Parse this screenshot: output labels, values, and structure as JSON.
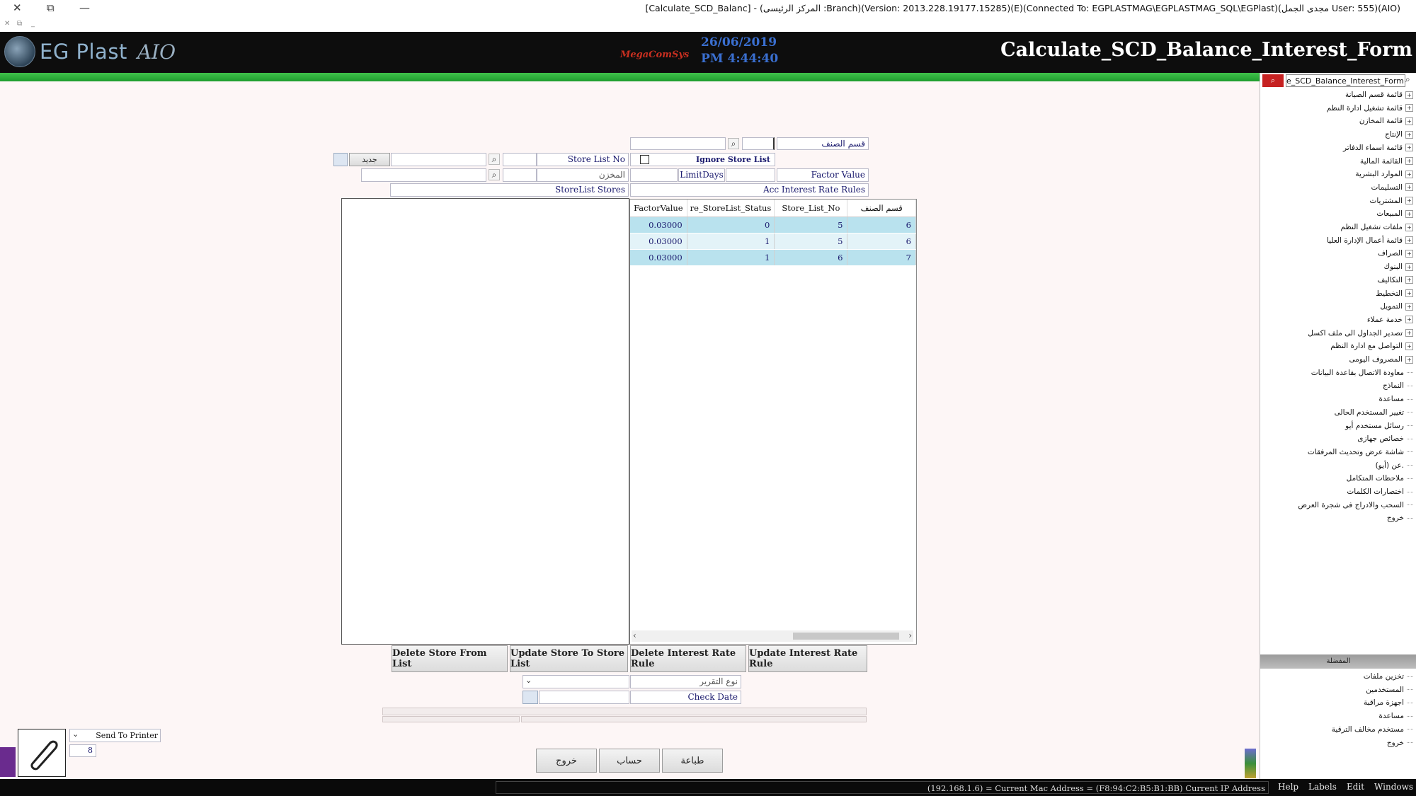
{
  "window": {
    "title": "[Calculate_SCD_Balanc] - (المركز الرئيسى :Branch)(Version: 2013.228.19177.15285)(E)(Connected To: EGPLASTMAG\\EGPLASTMAG_SQL\\EGPlast)(مجدى الجمل User: 555)(AIO)",
    "close_glyph": "✕",
    "restore_glyph": "⧉",
    "minimize_glyph": "—"
  },
  "header": {
    "logo_name": "EG Plast",
    "logo_suffix": "AIO",
    "mini_logo": "MegaComSys",
    "date": "26/06/2019",
    "time": "PM 4:44:40",
    "form_title": "Calculate_SCD_Balance_Interest_Form"
  },
  "form": {
    "item_category_label": "قسم الصنف",
    "item_category_value": "",
    "item_category_desc": "",
    "ignore_store_list_label": "Ignore Store List",
    "ignore_store_list_checked": false,
    "store_list_no_label": "Store List No",
    "store_list_no_value": "",
    "store_list_name": "",
    "new_label": "جديد",
    "factor_value_label": "Factor Value",
    "factor_value": "",
    "limit_days_label": "LimitDays",
    "limit_days_value": "",
    "store_label": "المخزن",
    "store_value": "",
    "store_name": "",
    "acc_interest_rate_rules_label": "Acc Interest Rate Rules",
    "storelist_stores_label": "StoreList Stores"
  },
  "grid": {
    "columns": [
      "FactorValue",
      "re_StoreList_Status",
      "Store_List_No",
      "قسم الصنف"
    ],
    "rows": [
      {
        "factor": "0.03000",
        "status": "0",
        "store_list_no": "5",
        "category": "6"
      },
      {
        "factor": "0.03000",
        "status": "1",
        "store_list_no": "5",
        "category": "6"
      },
      {
        "factor": "0.03000",
        "status": "1",
        "store_list_no": "6",
        "category": "7"
      }
    ]
  },
  "actions": {
    "delete_store": "Delete Store From List",
    "update_store": "Update Store To Store List",
    "delete_rule": "Delete Interest Rate Rule",
    "update_rule": "Update Interest Rate Rule"
  },
  "report": {
    "report_type_label": "نوع التقرير",
    "report_type_value": "",
    "check_date_label": "Check Date",
    "check_date_value": ""
  },
  "bottom": {
    "send_to_printer": "Send To Printer",
    "copies": "8",
    "exit": "خروج",
    "calculate": "حساب",
    "print": "طباعة"
  },
  "sidebar": {
    "search_value": "e_SCD_Balance_Interest_Form",
    "tree_items": [
      {
        "label": "قائمة قسم الصيانة",
        "expandable": true
      },
      {
        "label": "قائمة تشغيل ادارة النظم",
        "expandable": true
      },
      {
        "label": "قائمة المخازن",
        "expandable": true
      },
      {
        "label": "الإنتاج",
        "expandable": true
      },
      {
        "label": "قائمة اسماء الدفاتر",
        "expandable": true
      },
      {
        "label": "القائمة المالية",
        "expandable": true
      },
      {
        "label": "الموارد البشرية",
        "expandable": true
      },
      {
        "label": "التسليمات",
        "expandable": true
      },
      {
        "label": "المشتريات",
        "expandable": true
      },
      {
        "label": "المبيعات",
        "expandable": true
      },
      {
        "label": "ملفات تشغيل النظم",
        "expandable": true
      },
      {
        "label": "قائمة أعمال الإدارة العليا",
        "expandable": true
      },
      {
        "label": "الصراف",
        "expandable": true
      },
      {
        "label": "البنوك",
        "expandable": true
      },
      {
        "label": "التكاليف",
        "expandable": true
      },
      {
        "label": "التخطيط",
        "expandable": true
      },
      {
        "label": "التمويل",
        "expandable": true
      },
      {
        "label": "خدمة عملاء",
        "expandable": true
      },
      {
        "label": "تصدير الجداول الى ملف اكسل",
        "expandable": true
      },
      {
        "label": "التواصل مع ادارة النظم",
        "expandable": true
      },
      {
        "label": "المصروف اليومى",
        "expandable": true
      },
      {
        "label": "معاودة الاتصال بقاعدة البيانات",
        "expandable": false
      },
      {
        "label": "النماذج",
        "expandable": false
      },
      {
        "label": "مساعدة",
        "expandable": false
      },
      {
        "label": "تغيير المستخدم الحالى",
        "expandable": false
      },
      {
        "label": "رسائل مستخدم أيو",
        "expandable": false
      },
      {
        "label": "خصائص جهازى",
        "expandable": false
      },
      {
        "label": "شاشة عرض وتحديث المرفقات",
        "expandable": false
      },
      {
        "label": "عن (أيو).",
        "expandable": false
      },
      {
        "label": "ملاحظات المتكامل",
        "expandable": false
      },
      {
        "label": "اختصارات الكلمات",
        "expandable": false
      },
      {
        "label": "السحب والادراج فى شجرة العرض",
        "expandable": false
      },
      {
        "label": "خروج",
        "expandable": false
      }
    ],
    "favorites_title": "المفضلة",
    "favorites": [
      {
        "label": "تخزين ملفات"
      },
      {
        "label": "المستخدمين"
      },
      {
        "label": "اجهزة مراقبة"
      },
      {
        "label": "مساعدة"
      },
      {
        "label": "مستخدم مخالف الترقية"
      },
      {
        "label": "خروج"
      }
    ]
  },
  "statusbar": {
    "network_info": "(192.168.1.6) = Current Mac Address = (F8:94:C2:B5:B1:BB) Current IP Address",
    "menu": [
      "Help",
      "Labels",
      "Edit",
      "Windows"
    ]
  },
  "colors": {
    "accent_green": "#2eb33c",
    "header_bg": "#0d0d0d",
    "row_highlight": "#b9e2ee",
    "row_alt": "#e3f3f8",
    "label_text": "#1a1a6e",
    "search_red": "#c62121"
  },
  "icons": [
    "close-icon",
    "restore-icon",
    "minimize-icon",
    "search-icon",
    "calendar-icon",
    "paperclip-icon",
    "chevron-down-icon",
    "expand-icon"
  ]
}
